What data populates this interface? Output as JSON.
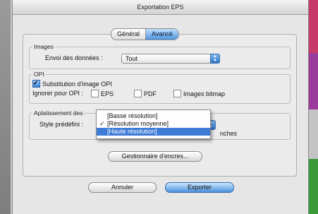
{
  "window": {
    "title": "Exportation EPS"
  },
  "tabs": [
    {
      "label": "Général",
      "active": false
    },
    {
      "label": "Avancé",
      "active": true
    }
  ],
  "images": {
    "legend": "Images",
    "send_label": "Envoi des données :",
    "send_value": "Tout"
  },
  "opi": {
    "legend": "OPI",
    "substitution_label": "Substitution d'image OPI",
    "substitution_checked": true,
    "ignore_label": "Ignorer pour OPI :",
    "ignore_options": [
      {
        "label": "EPS",
        "checked": false
      },
      {
        "label": "PDF",
        "checked": false
      },
      {
        "label": "Images bitmap",
        "checked": false
      }
    ]
  },
  "flattening": {
    "legend_visible": "Aplatissement des",
    "style_label": "Style prédéfini :",
    "partial_text": "nches",
    "menu_options": [
      {
        "label": "[Basse résolution]",
        "checked": false,
        "highlighted": false
      },
      {
        "label": "[Résolution moyenne]",
        "checked": true,
        "highlighted": false
      },
      {
        "label": "[Haute résolution]",
        "checked": false,
        "highlighted": true
      }
    ]
  },
  "ink_manager_label": "Gestionnaire d'encres...",
  "footer": {
    "cancel_label": "Annuler",
    "export_label": "Exporter"
  },
  "colors": {
    "accent": "#3d7bd6",
    "right_strip": [
      "#c83a6a",
      "#9a3a9a",
      "#c8c8c8",
      "#3a9a3a"
    ]
  },
  "icons": {
    "checkmark": "check-icon",
    "popup_arrows": "updown-arrows-icon"
  }
}
